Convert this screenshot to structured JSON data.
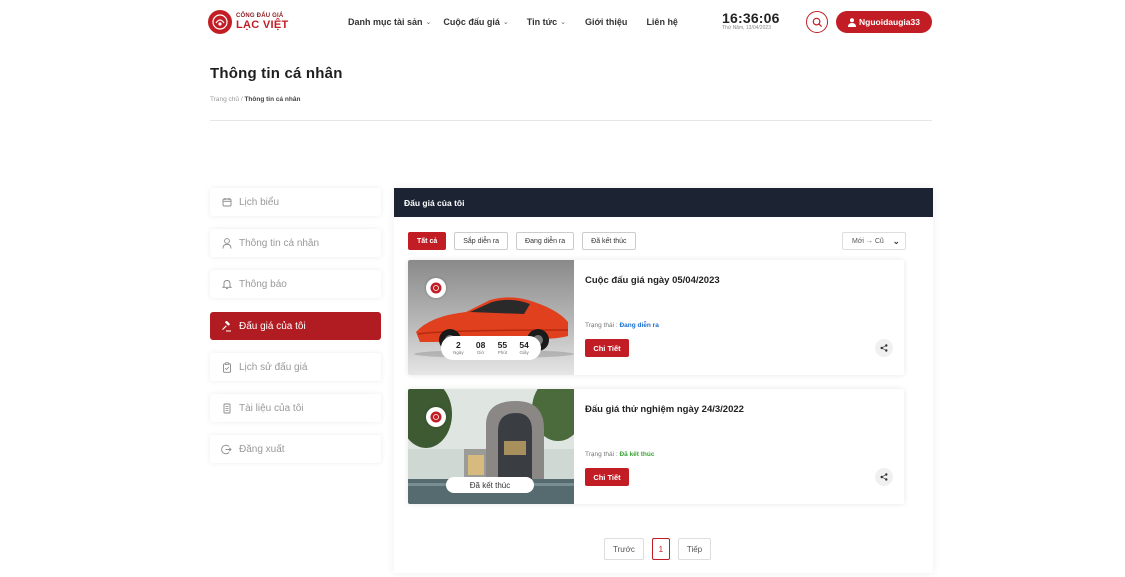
{
  "header": {
    "logo_top": "CỔNG ĐẤU GIÁ",
    "logo_main": "LẠC VIỆT",
    "nav": [
      {
        "label": "Danh mục tài sản",
        "has_dropdown": true
      },
      {
        "label": "Cuộc đấu giá",
        "has_dropdown": true
      },
      {
        "label": "Tin tức",
        "has_dropdown": true
      },
      {
        "label": "Giới thiệu",
        "has_dropdown": false
      },
      {
        "label": "Liên hệ",
        "has_dropdown": false
      }
    ],
    "clock_time": "16:36:06",
    "clock_date": "Thứ Năm, 13/04/2023",
    "user_label": "Nguoidaugia33"
  },
  "page": {
    "title": "Thông tin cá nhân",
    "breadcrumb_home": "Trang chủ",
    "breadcrumb_sep": " / ",
    "breadcrumb_current": "Thông tin cá nhân"
  },
  "sidebar": {
    "items": [
      {
        "label": "Lịch biểu",
        "icon": "calendar-icon",
        "active": false
      },
      {
        "label": "Thông tin cá nhân",
        "icon": "user-icon",
        "active": false
      },
      {
        "label": "Thông báo",
        "icon": "bell-icon",
        "active": false
      },
      {
        "label": "Đấu giá của tôi",
        "icon": "gavel-icon",
        "active": true
      },
      {
        "label": "Lịch sử đấu giá",
        "icon": "clipboard-icon",
        "active": false
      },
      {
        "label": "Tài liệu của tôi",
        "icon": "document-icon",
        "active": false
      },
      {
        "label": "Đăng xuất",
        "icon": "logout-icon",
        "active": false
      }
    ]
  },
  "main": {
    "heading": "Đấu giá của tôi",
    "filters": [
      {
        "label": "Tất cả",
        "active": true
      },
      {
        "label": "Sắp diễn ra",
        "active": false
      },
      {
        "label": "Đang diễn ra",
        "active": false
      },
      {
        "label": "Đã kết thúc",
        "active": false
      }
    ],
    "sort_value": "Mới → Cũ",
    "cards": [
      {
        "title": "Cuộc đấu giá ngày 05/04/2023",
        "status_label": "Trạng thái : ",
        "status_value": "Đang diễn ra",
        "status_color": "#1a6fd1",
        "detail_label": "Chi Tiết",
        "countdown": [
          {
            "num": "2",
            "label": "Ngày"
          },
          {
            "num": "08",
            "label": "Giờ"
          },
          {
            "num": "55",
            "label": "Phút"
          },
          {
            "num": "54",
            "label": "Giây"
          }
        ]
      },
      {
        "title": "Đấu giá thử nghiệm ngày 24/3/2022",
        "status_label": "Trạng thái : ",
        "status_value": "Đã kết thúc",
        "status_color": "#3aa335",
        "detail_label": "Chi Tiết",
        "ended_label": "Đã kết thúc"
      }
    ],
    "pagination": {
      "prev": "Trước",
      "current": "1",
      "next": "Tiếp"
    }
  },
  "colors": {
    "brand_red": "#c21d24",
    "panel_header": "#1c2333"
  }
}
